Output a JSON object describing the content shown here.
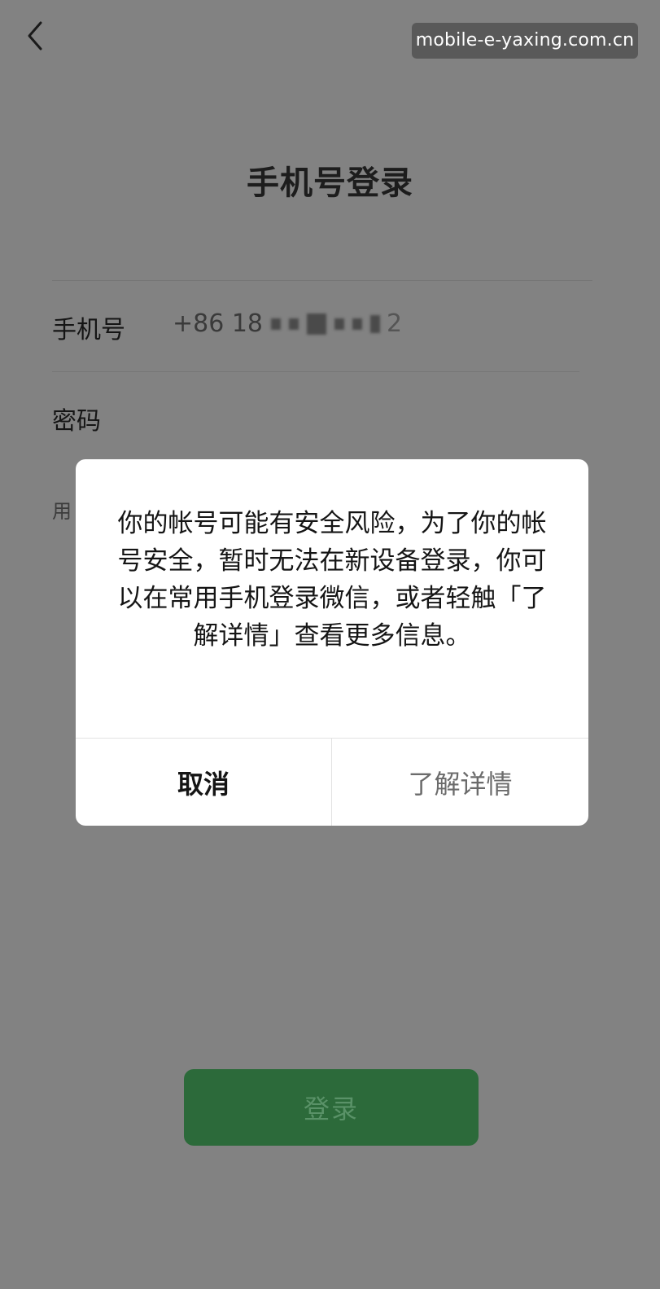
{
  "watermark": "mobile-e-yaxing.com.cn",
  "title": "手机号登录",
  "phone": {
    "label": "手机号",
    "prefix": "+86 18",
    "suffix": "2"
  },
  "password": {
    "label": "密码"
  },
  "hint_partial": "用",
  "login_button": "登录",
  "dialog": {
    "message": "你的帐号可能有安全风险，为了你的帐号安全，暂时无法在新设备登录，你可以在常用手机登录微信，或者轻触「了解详情」查看更多信息。",
    "cancel_label": "取消",
    "detail_label": "了解详情"
  },
  "colors": {
    "background": "#828282",
    "login_button": "#2c6a3a"
  },
  "icons": [
    "back-chevron-icon",
    "more-dots-icon"
  ]
}
